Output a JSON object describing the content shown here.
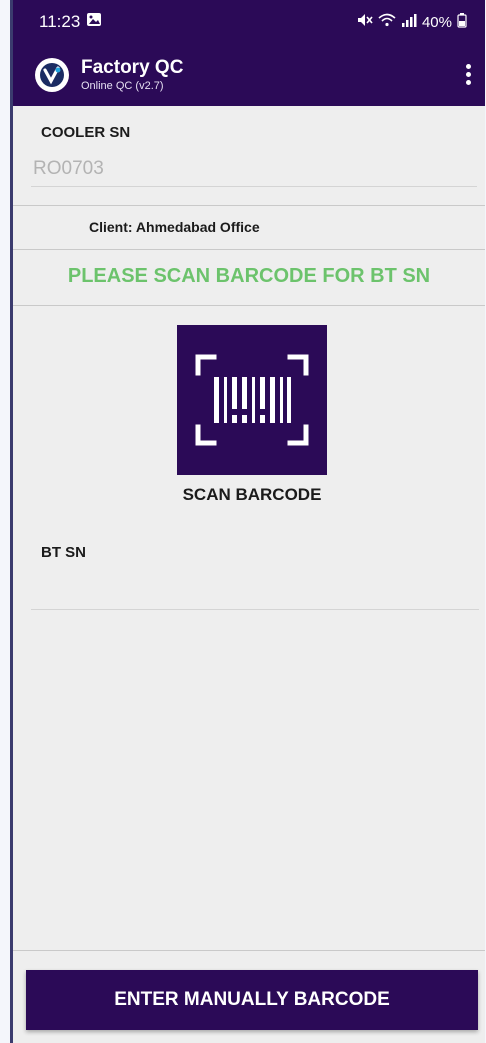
{
  "status_bar": {
    "time": "11:23",
    "battery": "40%",
    "icons": [
      "image-icon",
      "mute-icon",
      "wifi-icon",
      "signal-icon",
      "battery-icon"
    ]
  },
  "app_bar": {
    "title": "Factory QC",
    "subtitle": "Online QC (v2.7)",
    "color": "#2b0a57",
    "logo_icon": "app-logo-icon",
    "menu_icon": "more-vertical-icon"
  },
  "cooler": {
    "label": "COOLER SN",
    "value": "RO0703"
  },
  "client": "Client: Ahmedabad Office",
  "scan": {
    "prompt": "PLEASE SCAN BARCODE FOR BT SN",
    "prompt_color": "#6cc36c",
    "icon": "barcode-scan-icon",
    "caption": "SCAN BARCODE"
  },
  "bt_sn": {
    "label": "BT SN",
    "value": ""
  },
  "footer": {
    "manual_button": "ENTER MANUALLY BARCODE"
  }
}
